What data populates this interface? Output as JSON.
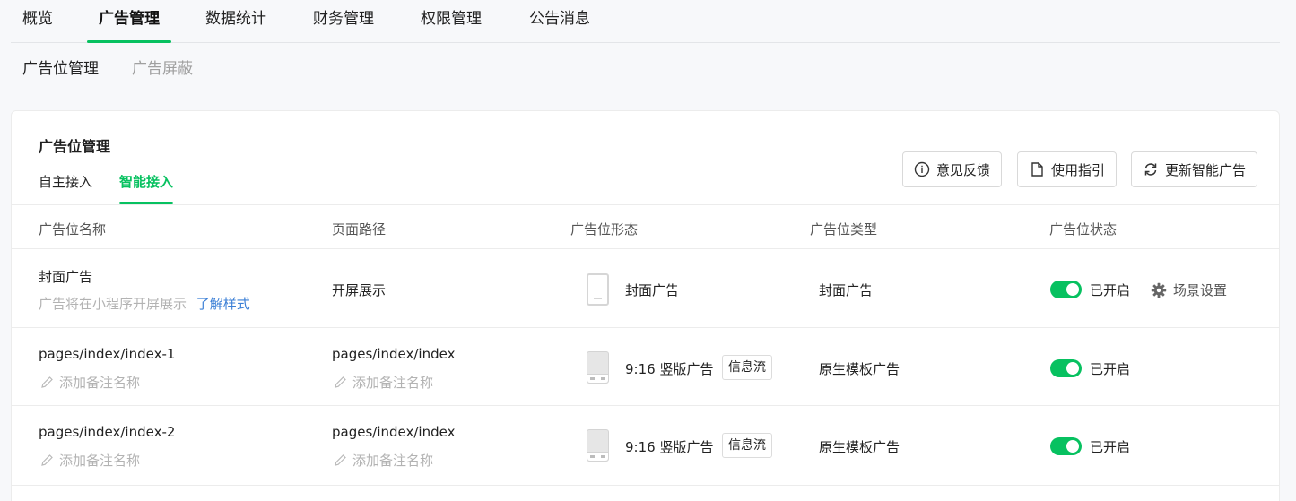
{
  "top_nav": [
    "概览",
    "广告管理",
    "数据统计",
    "财务管理",
    "权限管理",
    "公告消息"
  ],
  "sub_nav": [
    "广告位管理",
    "广告屏蔽"
  ],
  "card": {
    "title": "广告位管理",
    "tabs": [
      "自主接入",
      "智能接入"
    ],
    "active_tab": "智能接入",
    "buttons": {
      "feedback": "意见反馈",
      "guide": "使用指引",
      "refresh": "更新智能广告"
    }
  },
  "table": {
    "headers": [
      "广告位名称",
      "页面路径",
      "广告位形态",
      "广告位类型",
      "广告位状态"
    ],
    "rows": [
      {
        "name": "封面广告",
        "desc": "广告将在小程序开屏展示",
        "desc_link": "了解样式",
        "path": "开屏展示",
        "form": "封面广告",
        "type": "封面广告",
        "status": "已开启",
        "scene": "场景设置"
      },
      {
        "name": "pages/index/index-1",
        "remark": "添加备注名称",
        "path": "pages/index/index",
        "path_remark": "添加备注名称",
        "form": "9:16 竖版广告",
        "form_tag": "信息流",
        "type": "原生模板广告",
        "status": "已开启"
      },
      {
        "name": "pages/index/index-2",
        "remark": "添加备注名称",
        "path": "pages/index/index",
        "path_remark": "添加备注名称",
        "form": "9:16 竖版广告",
        "form_tag": "信息流",
        "type": "原生模板广告",
        "status": "已开启"
      }
    ]
  },
  "colors": {
    "accent": "#07c160",
    "link": "#3b7fd6"
  }
}
